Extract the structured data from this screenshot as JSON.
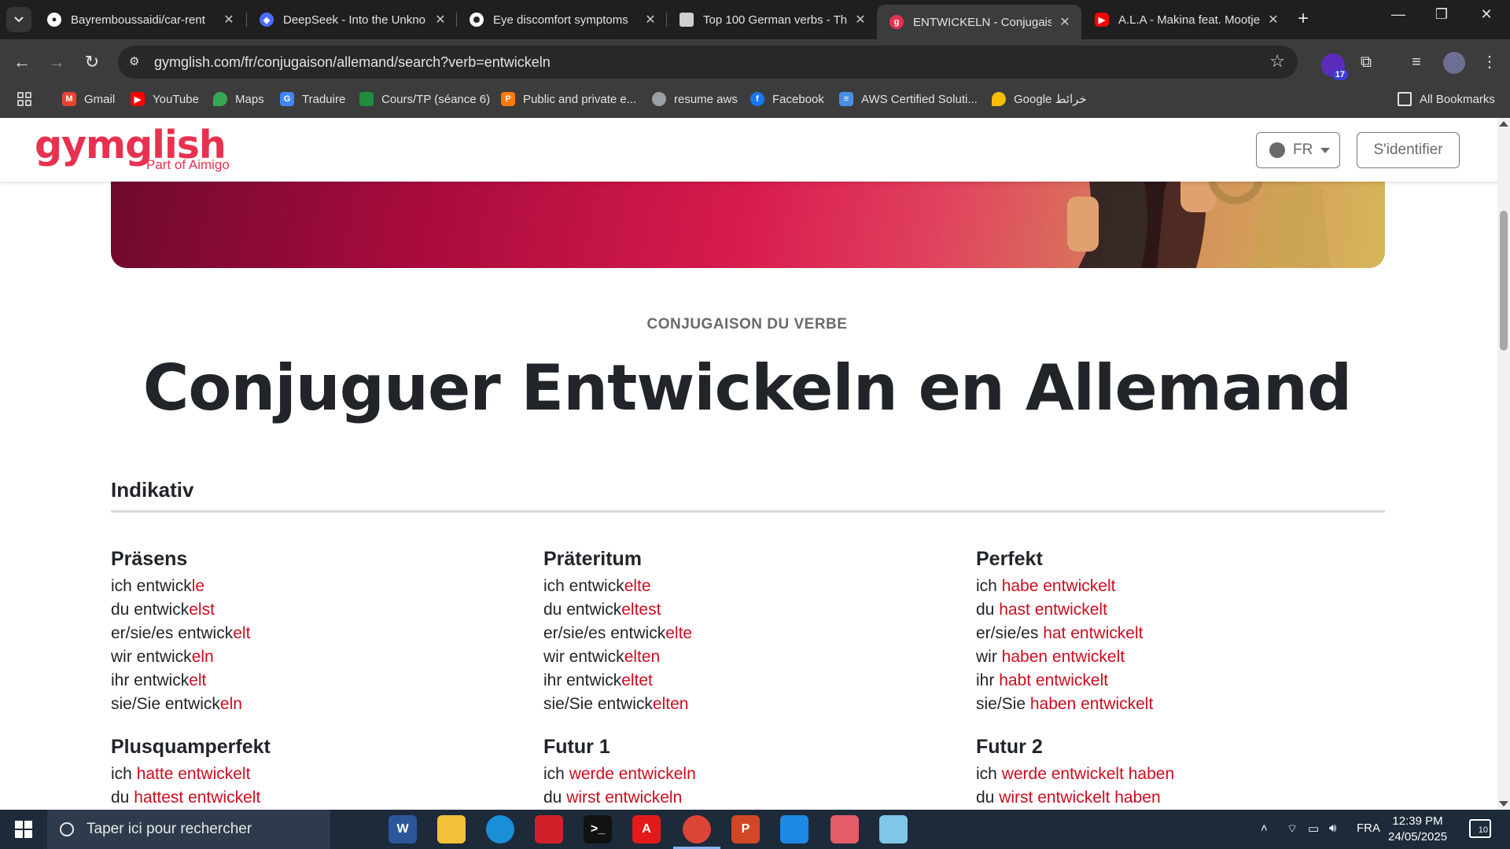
{
  "browser": {
    "tabs": [
      {
        "title": "Bayremboussaidi/car-rent",
        "icon": "github-icon",
        "color": "#ffffff"
      },
      {
        "title": "DeepSeek - Into the Unkno",
        "icon": "deepseek-icon",
        "color": "#4d6bfe"
      },
      {
        "title": "Eye discomfort symptoms",
        "icon": "chatgpt-icon",
        "color": "#ffffff"
      },
      {
        "title": "Top 100 German verbs - Th",
        "icon": "page-icon",
        "color": "#cfcfcf"
      },
      {
        "title": "ENTWICKELN - Conjugaiso",
        "icon": "gymglish-icon",
        "color": "#e8314f"
      },
      {
        "title": "A.L.A - Makina feat. Mootje",
        "icon": "youtube-icon",
        "color": "#ff0000"
      }
    ],
    "active_tab": 4,
    "url": "gymglish.com/fr/conjugaison/allemand/search?verb=entwickeln",
    "extension_badge": "17",
    "bookmarks": [
      {
        "label": "Gmail",
        "icon": "gmail-icon",
        "color": "#ea4335"
      },
      {
        "label": "YouTube",
        "icon": "youtube-icon",
        "color": "#ff0000"
      },
      {
        "label": "Maps",
        "icon": "maps-icon",
        "color": "#34a853"
      },
      {
        "label": "Traduire",
        "icon": "translate-icon",
        "color": "#4285f4"
      },
      {
        "label": "Cours/TP (séance 6)",
        "icon": "classroom-icon",
        "color": "#1e8e3e"
      },
      {
        "label": "Public and private e...",
        "icon": "pearson-icon",
        "color": "#ff7a00"
      },
      {
        "label": "resume aws",
        "icon": "globe-icon",
        "color": "#9aa0a6"
      },
      {
        "label": "Facebook",
        "icon": "facebook-icon",
        "color": "#1877f2"
      },
      {
        "label": "AWS Certified Soluti...",
        "icon": "list-icon",
        "color": "#4a90e2"
      },
      {
        "label": "Google خرائط",
        "icon": "maps-icon",
        "color": "#fbbc04"
      }
    ],
    "all_bookmarks": "All Bookmarks"
  },
  "site": {
    "logo": "gymglish",
    "logo_sub": "Part of Aimigo",
    "lang": "FR",
    "login": "S'identifier",
    "brand_color": "#e8314f",
    "ending_color": "#cc0c1f"
  },
  "content": {
    "eyebrow": "CONJUGAISON DU VERBE",
    "title": "Conjuguer Entwickeln en Allemand",
    "mood": "Indikativ",
    "tenses": [
      {
        "name": "Präsens",
        "rows": [
          {
            "stem": "ich entwick",
            "end": "le"
          },
          {
            "stem": "du entwick",
            "end": "elst"
          },
          {
            "stem": "er/sie/es entwick",
            "end": "elt"
          },
          {
            "stem": "wir entwick",
            "end": "eln"
          },
          {
            "stem": "ihr entwick",
            "end": "elt"
          },
          {
            "stem": "sie/Sie entwick",
            "end": "eln"
          }
        ]
      },
      {
        "name": "Präteritum",
        "rows": [
          {
            "stem": "ich entwick",
            "end": "elte"
          },
          {
            "stem": "du entwick",
            "end": "eltest"
          },
          {
            "stem": "er/sie/es entwick",
            "end": "elte"
          },
          {
            "stem": "wir entwick",
            "end": "elten"
          },
          {
            "stem": "ihr entwick",
            "end": "eltet"
          },
          {
            "stem": "sie/Sie entwick",
            "end": "elten"
          }
        ]
      },
      {
        "name": "Perfekt",
        "rows": [
          {
            "stem": "ich ",
            "end": "habe entwickelt"
          },
          {
            "stem": "du ",
            "end": "hast entwickelt"
          },
          {
            "stem": "er/sie/es ",
            "end": "hat entwickelt"
          },
          {
            "stem": "wir ",
            "end": "haben entwickelt"
          },
          {
            "stem": "ihr ",
            "end": "habt entwickelt"
          },
          {
            "stem": "sie/Sie ",
            "end": "haben entwickelt"
          }
        ]
      },
      {
        "name": "Plusquamperfekt",
        "rows": [
          {
            "stem": "ich ",
            "end": "hatte entwickelt"
          },
          {
            "stem": "du ",
            "end": "hattest entwickelt"
          }
        ]
      },
      {
        "name": "Futur 1",
        "rows": [
          {
            "stem": "ich ",
            "end": "werde entwickeln"
          },
          {
            "stem": "du ",
            "end": "wirst entwickeln"
          }
        ]
      },
      {
        "name": "Futur 2",
        "rows": [
          {
            "stem": "ich ",
            "end": "werde entwickelt haben"
          },
          {
            "stem": "du ",
            "end": "wirst entwickelt haben"
          }
        ]
      }
    ]
  },
  "taskbar": {
    "search_placeholder": "Taper ici pour rechercher",
    "apps": [
      {
        "name": "task-view-icon",
        "label": "",
        "color": "#1c2a3a"
      },
      {
        "name": "word-icon",
        "label": "W",
        "color": "#2b579a"
      },
      {
        "name": "file-explorer-icon",
        "label": "",
        "color": "#f3c13a"
      },
      {
        "name": "edge-icon",
        "label": "",
        "color": "#1a8fd8"
      },
      {
        "name": "app-red-icon",
        "label": "",
        "color": "#d0202a"
      },
      {
        "name": "terminal-icon",
        "label": ">_",
        "color": "#111111"
      },
      {
        "name": "acrobat-icon",
        "label": "A",
        "color": "#e21a1a"
      },
      {
        "name": "chrome-icon",
        "label": "",
        "color": "#db4437"
      },
      {
        "name": "powerpoint-icon",
        "label": "P",
        "color": "#d24726"
      },
      {
        "name": "photos-icon",
        "label": "",
        "color": "#1e88e5"
      },
      {
        "name": "snipping-icon",
        "label": "",
        "color": "#e45b6a"
      },
      {
        "name": "notepad-icon",
        "label": "",
        "color": "#7fc6e8"
      }
    ],
    "active_app": 7,
    "language": "FRA",
    "time": "12:39 PM",
    "date": "24/05/2025",
    "notifications": "10"
  }
}
